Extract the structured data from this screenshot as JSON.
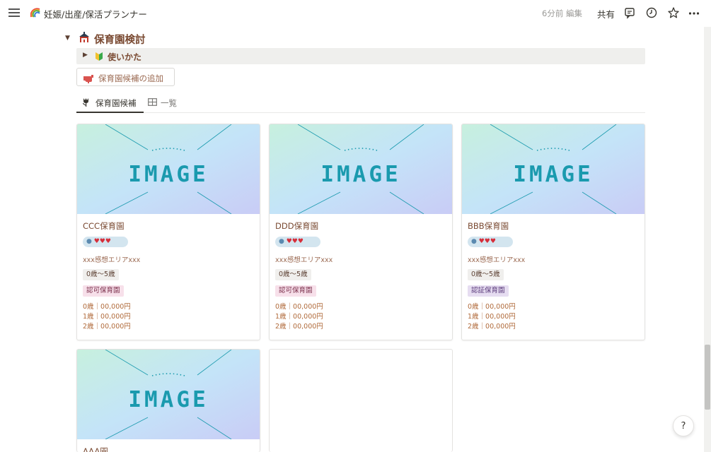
{
  "topbar": {
    "page_title": "妊娠/出産/保活プランナー",
    "page_icon": "rainbow-icon",
    "edit_meta": "6分前 編集",
    "share_label": "共有",
    "icons": [
      "menu-icon",
      "comment-icon",
      "clock-icon",
      "star-icon",
      "more-icon"
    ]
  },
  "section": {
    "title": "保育園検討",
    "icon": "nursery-icon",
    "howto_label": "使いかた",
    "add_button_label": "保育園候補の追加"
  },
  "tabs": [
    {
      "label": "保育園候補",
      "icon": "tulip-icon",
      "active": true
    },
    {
      "label": "一覧",
      "icon": "table-icon",
      "active": false
    }
  ],
  "cards": [
    {
      "name": "CCC保育園",
      "rating": "●♥♥♥",
      "area": "xxx感想エリアxxx",
      "age": "0歳～5歳",
      "type": "認可保育園",
      "type_color": "#f7e0ea",
      "fees": [
        "0歳｜00,000円",
        "1歳｜00,000円",
        "2歳｜00,000円"
      ]
    },
    {
      "name": "DDD保育園",
      "rating": "●♥♥♥",
      "area": "xxx感想エリアxxx",
      "age": "0歳～5歳",
      "type": "認可保育園",
      "type_color": "#f7e0ea",
      "fees": [
        "0歳｜00,000円",
        "1歳｜00,000円",
        "2歳｜00,000円"
      ]
    },
    {
      "name": "BBB保育園",
      "rating": "●♥♥♥",
      "area": "xxx感想エリアxxx",
      "age": "0歳～5歳",
      "type": "認証保育園",
      "type_color": "#e6ddf1",
      "fees": [
        "0歳｜00,000円",
        "1歳｜00,000円",
        "2歳｜00,000円"
      ]
    },
    {
      "name": "AAA園"
    }
  ],
  "cover_text": "IMAGE",
  "help_label": "?",
  "colors": {
    "accent_brown": "#7a4a32",
    "heart_red": "#d62e3a",
    "cover_teal": "#1a9aae"
  }
}
